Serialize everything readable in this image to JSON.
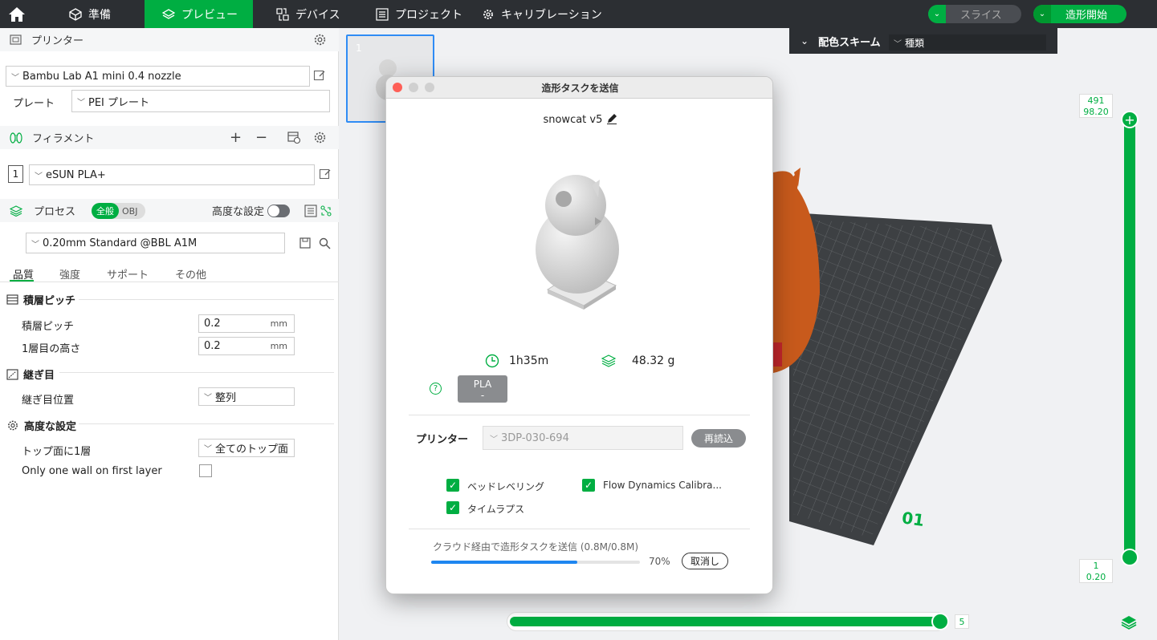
{
  "topbar": {
    "tabs": [
      {
        "label": "準備"
      },
      {
        "label": "プレビュー"
      },
      {
        "label": "デバイス"
      },
      {
        "label": "プロジェクト"
      },
      {
        "label": "キャリブレーション"
      }
    ],
    "slice_label": "スライス",
    "print_label": "造形開始"
  },
  "left": {
    "printer_section": "プリンター",
    "printer_name": "Bambu Lab A1 mini 0.4 nozzle",
    "plate_label": "プレート",
    "plate_value": "PEI プレート",
    "filament_section": "フィラメント",
    "filament_index": "1",
    "filament_name": "eSUN PLA+",
    "process_section": "プロセス",
    "process_toggle_general": "全般",
    "process_toggle_obj": "OBJ",
    "advanced_label": "高度な設定",
    "process_profile": "0.20mm Standard @BBL A1M",
    "tabs": [
      "品質",
      "強度",
      "サポート",
      "その他"
    ],
    "groups": {
      "layer": "積層ピッチ",
      "seam": "継ぎ目",
      "advanced": "高度な設定"
    },
    "layer_height_label": "積層ピッチ",
    "layer_height_value": "0.2",
    "first_layer_label": "1層目の高さ",
    "first_layer_value": "0.2",
    "unit_mm": "mm",
    "seam_pos_label": "継ぎ目位置",
    "seam_pos_value": "整列",
    "top_one_wall_label": "トップ面に1層",
    "top_one_wall_value": "全てのトップ面",
    "only_one_wall_label": "Only one wall on first layer"
  },
  "viewport": {
    "color_scheme_label": "配色スキーム",
    "color_scheme_value": "種類",
    "thumb_index": "1",
    "slider_top_layer": "491",
    "slider_top_height": "98.20",
    "slider_bottom_layer": "1",
    "slider_bottom_height": "0.20",
    "h_slider_value": "5",
    "plate_number": "01"
  },
  "dialog": {
    "title": "造形タスクを送信",
    "project_name": "snowcat v5",
    "time": "1h35m",
    "weight": "48.32 g",
    "filament_type": "PLA",
    "filament_slot": "-",
    "printer_label": "プリンター",
    "printer_value": "3DP-030-694",
    "reload_label": "再読込",
    "opt_bed_leveling": "ベッドレベリング",
    "opt_flow": "Flow Dynamics Calibra...",
    "opt_timelapse": "タイムラプス",
    "progress_text": "クラウド経由で造形タスクを送信 (0.8M/0.8M)",
    "progress_percent": "70%",
    "progress_value": 0.7,
    "cancel_label": "取消し"
  }
}
